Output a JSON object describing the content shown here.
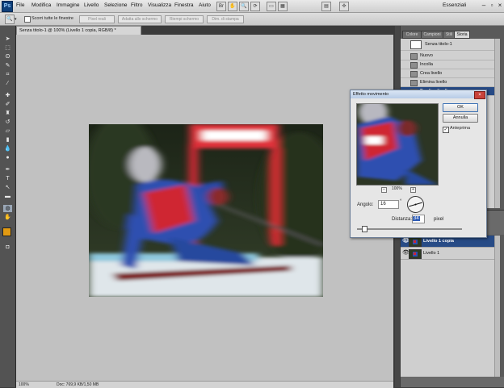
{
  "app": {
    "logo": "Ps",
    "workspace": "Essenziali"
  },
  "menu": [
    "File",
    "Modifica",
    "Immagine",
    "Livello",
    "Selezione",
    "Filtro",
    "Visualizza",
    "Finestra",
    "Aiuto"
  ],
  "options_bar": {
    "checkbox_label": "Scorri tutte le finestre",
    "buttons": [
      "Pixel reali",
      "Adatta allo schermo",
      "Riempi schermo",
      "Dim. di stampa"
    ]
  },
  "document": {
    "tab_title": "Senza titolo-1 @ 100% (Livello 1 copia, RGB/8) *",
    "status_zoom": "100%",
    "status_doc": "Doc: 769,9 KB/1,50 MB"
  },
  "history_panel": {
    "tabs": [
      "Colore",
      "Campioni",
      "Stili",
      "Storia"
    ],
    "active_tab": "Storia",
    "snapshot": "Senza titolo-1",
    "items": [
      "Nuovo",
      "Incolla",
      "Crea livello",
      "Elimina livello",
      "Duplica livello"
    ],
    "selected_item": "Duplica livello"
  },
  "layers_panel": {
    "layers": [
      {
        "name": "Livello 1 copia",
        "selected": true
      },
      {
        "name": "Livello 1",
        "selected": false
      }
    ]
  },
  "dialog": {
    "title": "Effetto movimento",
    "ok": "OK",
    "cancel": "Annulla",
    "preview_label": "Anteprima",
    "preview_checked": true,
    "zoom": "100%",
    "angle_label": "Angolo:",
    "angle_value": "16",
    "degree_symbol": "°",
    "distance_label": "Distanza:",
    "distance_value": "34",
    "distance_unit": "pixel",
    "slider_fraction": 0.06
  },
  "colors": {
    "selection": "#274b86",
    "canvas_bg": "#c1c1c1",
    "panel_bg": "#5a5a5a"
  }
}
